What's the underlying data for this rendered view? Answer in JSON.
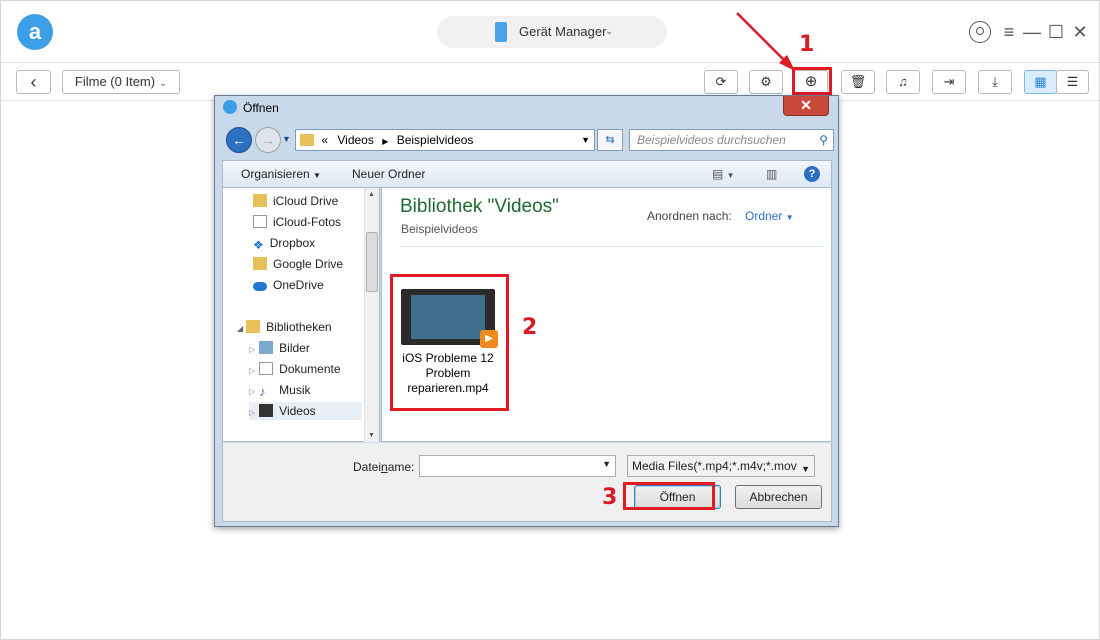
{
  "app": {
    "device_label": "Gerät Manager",
    "category_dropdown": "Filme (0 Item)"
  },
  "toolbar": {
    "back_label": "‹"
  },
  "annotations": {
    "step1": "1",
    "step2": "2",
    "step3": "3"
  },
  "dialog": {
    "title": "Öffnen",
    "address": {
      "prefix": "«",
      "crumb1": "Videos",
      "separator": "▶",
      "crumb2": "Beispielvideos"
    },
    "search_placeholder": "Beispielvideos durchsuchen",
    "command_bar": {
      "organize": "Organisieren",
      "new_folder": "Neuer Ordner"
    },
    "nav_items": [
      {
        "label": "iCloud Drive",
        "icon": "folder-icon"
      },
      {
        "label": "iCloud-Fotos",
        "icon": "document-icon"
      },
      {
        "label": "Dropbox",
        "icon": "dropbox-icon"
      },
      {
        "label": "Google Drive",
        "icon": "folder-icon"
      },
      {
        "label": "OneDrive",
        "icon": "cloud-icon"
      },
      {
        "label": "Bibliotheken",
        "icon": "libraries-icon"
      },
      {
        "label": "Bilder",
        "icon": "pictures-icon"
      },
      {
        "label": "Dokumente",
        "icon": "documents-icon"
      },
      {
        "label": "Musik",
        "icon": "music-icon"
      },
      {
        "label": "Videos",
        "icon": "video-icon"
      }
    ],
    "library_title": "Bibliothek \"Videos\"",
    "library_subtitle": "Beispielvideos",
    "arrange_label": "Anordnen nach:",
    "arrange_value": "Ordner",
    "file": {
      "name": "iOS Probleme 12 Problem reparieren.mp4"
    },
    "filename_label_pre": "Datei",
    "filename_label_u": "n",
    "filename_label_post": "ame:",
    "filename_value": "",
    "filetype": "Media Files(*.mp4;*.m4v;*.mov",
    "open_button": "Öffnen",
    "cancel_button": "Abbrechen"
  },
  "colors": {
    "accent": "#3d9ee8",
    "annotation_red": "#e01b24",
    "library_title_green": "#1e6b2f"
  }
}
